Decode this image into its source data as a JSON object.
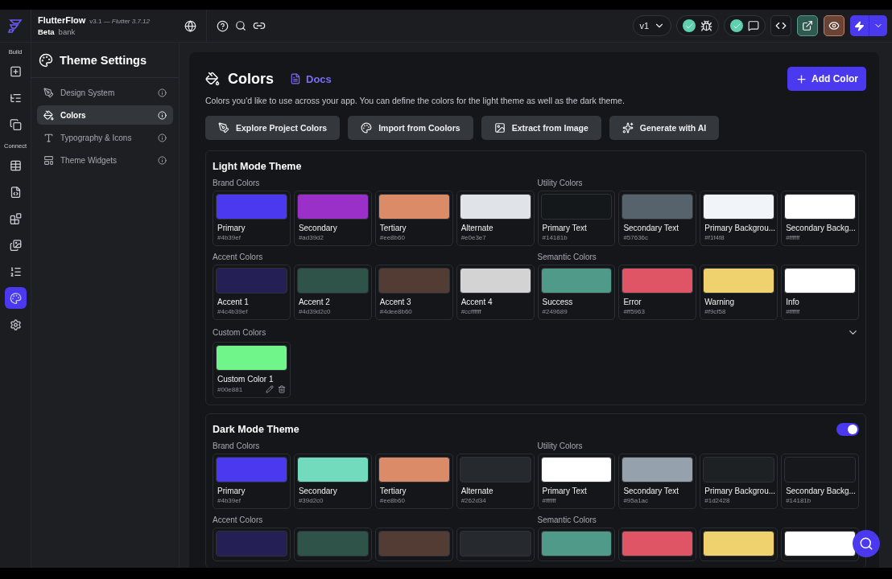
{
  "topbar": {
    "app_name": "FlutterFlow",
    "version": "v3.1 — *Flutter 3.7.12*",
    "channel": "Beta",
    "project": "bank",
    "branch": "v1"
  },
  "rail": [
    {
      "kind": "label",
      "text": "Build"
    },
    {
      "kind": "icon",
      "selected": false
    },
    {
      "kind": "icon",
      "selected": false
    },
    {
      "kind": "icon",
      "selected": false
    },
    {
      "kind": "label",
      "text": "Connect"
    },
    {
      "kind": "icon",
      "selected": false
    },
    {
      "kind": "icon",
      "selected": false
    },
    {
      "kind": "icon",
      "selected": false
    },
    {
      "kind": "icon",
      "selected": false
    },
    {
      "kind": "icon",
      "selected": false
    },
    {
      "kind": "icon",
      "selected": true
    },
    {
      "kind": "icon",
      "selected": false
    }
  ],
  "sidebar": {
    "title": "Theme Settings",
    "items": [
      {
        "label": "Design System",
        "selected": false
      },
      {
        "label": "Colors",
        "selected": true
      },
      {
        "label": "Typography & Icons",
        "selected": false
      },
      {
        "label": "Theme Widgets",
        "selected": false
      }
    ]
  },
  "header": {
    "title": "Colors",
    "docs": "Docs",
    "add_button": "Add Color",
    "description": "Colors you'd like to use across your app. You can define the colors for the light theme as well as the dark theme.",
    "actions": [
      "Explore Project Colors",
      "Import from Coolors",
      "Extract from Image",
      "Generate with AI"
    ]
  },
  "sections": [
    {
      "title": "Light Mode Theme",
      "groups": [
        {
          "kind": "half",
          "label": "Brand Colors",
          "items": [
            {
              "name": "Primary",
              "hex": "#4b39ef",
              "color": "#4b39ef"
            },
            {
              "name": "Secondary",
              "hex": "#ad39d2",
              "color": "#9a30c8"
            },
            {
              "name": "Tertiary",
              "hex": "#ee8b60",
              "color": "#dc8b69"
            },
            {
              "name": "Alternate",
              "hex": "#e0e3e7",
              "color": "#e0e3e7"
            }
          ]
        },
        {
          "kind": "half",
          "label": "Utility Colors",
          "items": [
            {
              "name": "Primary Text",
              "hex": "#14181b",
              "color": "#14181b"
            },
            {
              "name": "Secondary Text",
              "hex": "#57636c",
              "color": "#57636c"
            },
            {
              "name": "Primary Backgrou...",
              "hex": "#f1f4f8",
              "color": "#f1f4f8"
            },
            {
              "name": "Secondary Backg...",
              "hex": "#ffffff",
              "color": "#ffffff"
            }
          ]
        },
        {
          "kind": "half",
          "label": "Accent Colors",
          "items": [
            {
              "name": "Accent 1",
              "hex": "#4c4b39ef",
              "color": "#241f55"
            },
            {
              "name": "Accent 2",
              "hex": "#4d39d2c0",
              "color": "#2f5249"
            },
            {
              "name": "Accent 3",
              "hex": "#4dee8b60",
              "color": "#523c34"
            },
            {
              "name": "Accent 4",
              "hex": "#ccffffff",
              "color": "#d3d3d3"
            }
          ]
        },
        {
          "kind": "half",
          "label": "Semantic Colors",
          "items": [
            {
              "name": "Success",
              "hex": "#249689",
              "color": "#4f9a89"
            },
            {
              "name": "Error",
              "hex": "#ff5963",
              "color": "#e05565"
            },
            {
              "name": "Warning",
              "hex": "#f9cf58",
              "color": "#efd26e"
            },
            {
              "name": "Info",
              "hex": "#ffffff",
              "color": "#ffffff"
            }
          ]
        },
        {
          "kind": "custom",
          "label": "Custom Colors",
          "items": [
            {
              "name": "Custom Color 1",
              "hex": "#00e881",
              "color": "#6ff58a"
            }
          ]
        }
      ]
    },
    {
      "title": "Dark Mode Theme",
      "toggle": {
        "on": true
      },
      "groups": [
        {
          "kind": "half",
          "label": "Brand Colors",
          "items": [
            {
              "name": "Primary",
              "hex": "#4b39ef",
              "color": "#4b39ef"
            },
            {
              "name": "Secondary",
              "hex": "#39d2c0",
              "color": "#72dbbd"
            },
            {
              "name": "Tertiary",
              "hex": "#ee8b60",
              "color": "#dc8b69"
            },
            {
              "name": "Alternate",
              "hex": "#262d34",
              "color": "#262a2e"
            }
          ]
        },
        {
          "kind": "half",
          "label": "Utility Colors",
          "items": [
            {
              "name": "Primary Text",
              "hex": "#ffffff",
              "color": "#ffffff"
            },
            {
              "name": "Secondary Text",
              "hex": "#95a1ac",
              "color": "#95a1ac"
            },
            {
              "name": "Primary Backgrou...",
              "hex": "#1d2428",
              "color": "#1d2123"
            },
            {
              "name": "Secondary Backg...",
              "hex": "#14181b",
              "color": "#16181b"
            }
          ]
        },
        {
          "kind": "half",
          "label": "Accent Colors",
          "items": [
            {
              "color": "#241f55"
            },
            {
              "color": "#2f5249"
            },
            {
              "color": "#523c34"
            },
            {
              "color": "#262a2e"
            }
          ]
        },
        {
          "kind": "half",
          "label": "Semantic Colors",
          "items": [
            {
              "color": "#4f9a89"
            },
            {
              "color": "#e05565"
            },
            {
              "color": "#efd26e"
            },
            {
              "color": "#ffffff"
            }
          ]
        }
      ]
    }
  ]
}
